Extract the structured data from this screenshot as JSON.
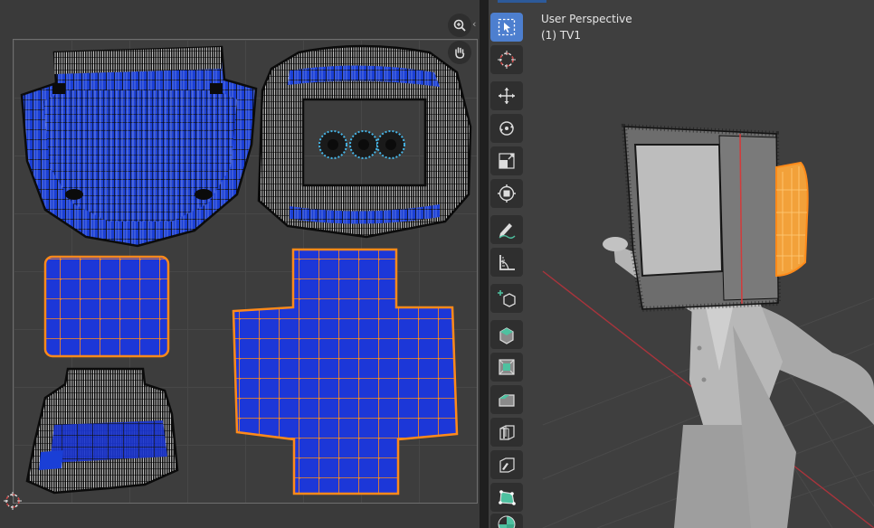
{
  "viewport": {
    "view_name": "User Perspective",
    "object_name": "(1) TV1"
  },
  "uv_editor": {
    "zoom_icon": "zoom-in-icon",
    "pan_icon": "hand-pan-icon",
    "cursor_icon": "2d-cursor-icon"
  },
  "toolbar": {
    "tools": [
      {
        "name": "select-box-tool",
        "icon": "select-box-icon",
        "active": true
      },
      {
        "name": "cursor-tool",
        "icon": "3d-cursor-icon",
        "active": false
      },
      {
        "name": "move-tool",
        "icon": "move-icon",
        "active": false
      },
      {
        "name": "rotate-tool",
        "icon": "rotate-icon",
        "active": false
      },
      {
        "name": "scale-tool",
        "icon": "scale-icon",
        "active": false
      },
      {
        "name": "transform-tool",
        "icon": "transform-icon",
        "active": false
      },
      {
        "name": "annotate-tool",
        "icon": "annotate-icon",
        "active": false
      },
      {
        "name": "measure-tool",
        "icon": "measure-icon",
        "active": false
      },
      {
        "name": "add-cube-tool",
        "icon": "add-cube-icon",
        "active": false
      },
      {
        "name": "extrude-tool",
        "icon": "extrude-icon",
        "active": false
      },
      {
        "name": "inset-faces-tool",
        "icon": "inset-faces-icon",
        "active": false
      },
      {
        "name": "bevel-tool",
        "icon": "bevel-icon",
        "active": false
      },
      {
        "name": "loop-cut-tool",
        "icon": "loop-cut-icon",
        "active": false
      },
      {
        "name": "knife-tool",
        "icon": "knife-icon",
        "active": false
      },
      {
        "name": "poly-build-tool",
        "icon": "poly-build-icon",
        "active": false
      },
      {
        "name": "spin-tool",
        "icon": "spin-icon",
        "active": false
      }
    ]
  },
  "colors": {
    "uv_face": "#1a3fd6",
    "uv_face_light": "#2f63e6",
    "uv_edge_unselected": "#0b0b0b",
    "uv_edge_selected": "#ff8a1a",
    "active_tool": "#4d7fcf",
    "axis_x": "#c8414d",
    "model_grey": "#a9a9a9"
  }
}
